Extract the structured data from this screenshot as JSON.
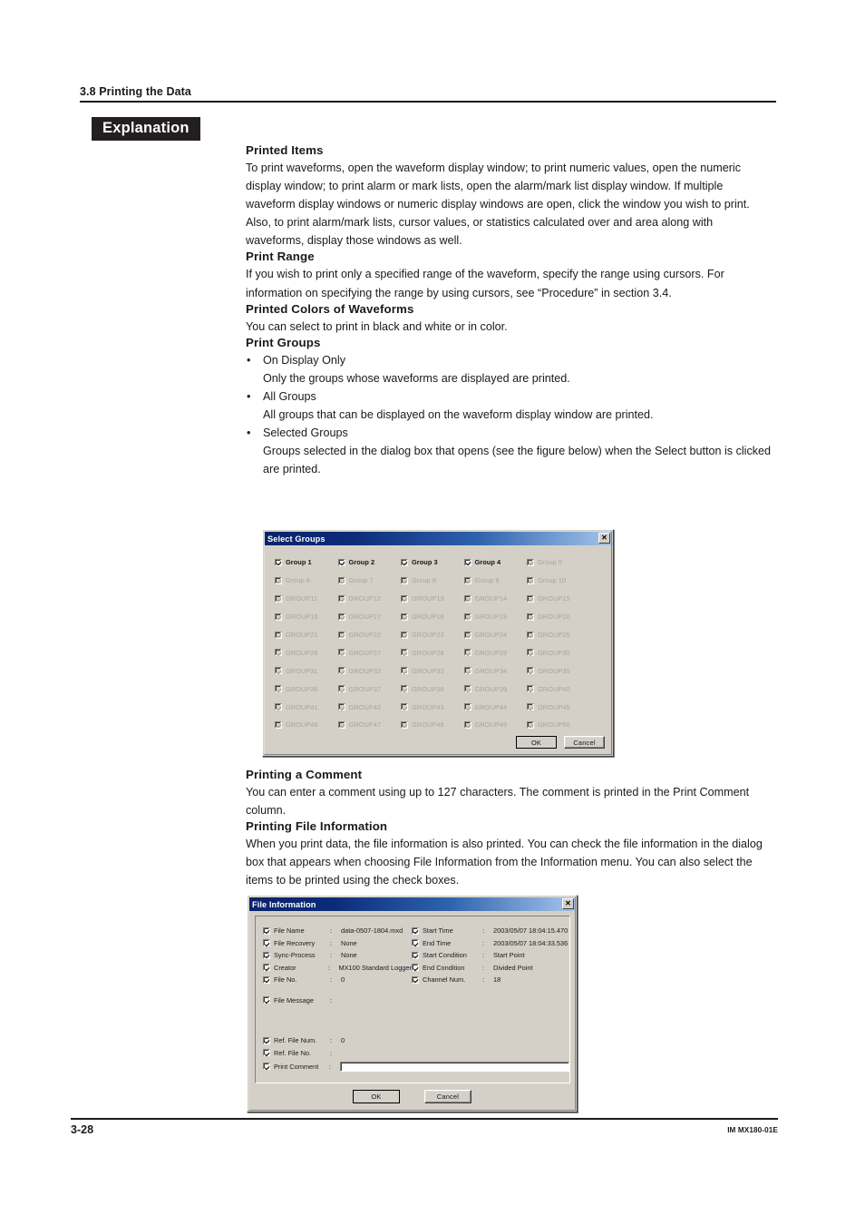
{
  "running_head": {
    "title": "3.8  Printing the Data"
  },
  "explanation_tag": {
    "label": "Explanation"
  },
  "sections": {
    "printed_items": {
      "heading": "Printed Items",
      "para1": "To print waveforms, open the waveform display window; to print numeric values, open the numeric display window; to print alarm or mark lists, open the alarm/mark list display window. If multiple waveform display windows or numeric display windows are open, click the window you wish to print.",
      "para2": "Also, to print alarm/mark lists, cursor values, or statistics calculated over and area along with waveforms, display those windows as well."
    },
    "print_range": {
      "heading": "Print Range",
      "para1": "If you wish to print only a specified range of the waveform, specify the range using cursors. For information on specifying the range by using cursors, see “Procedure” in section 3.4."
    },
    "printed_colors": {
      "heading": "Printed Colors of Waveforms",
      "para1": "You can select to print in black and white or in color."
    },
    "print_groups": {
      "heading": "Print Groups",
      "bullet_marker": "•",
      "items": [
        {
          "label": "On Display Only",
          "desc": "Only the groups whose waveforms are displayed are printed."
        },
        {
          "label": "All Groups",
          "desc": "All groups that can be displayed on the waveform display window are printed."
        },
        {
          "label": "Selected Groups",
          "desc": "Groups selected in the dialog box that opens (see the figure below) when the Select button is clicked are printed."
        }
      ]
    },
    "printing_comment": {
      "heading": "Printing a Comment",
      "para1": "You can enter a comment using up to 127 characters. The comment is printed in the Print Comment column."
    },
    "printing_file_info": {
      "heading": "Printing File Information",
      "para1": "When you print data, the file information is also printed. You can check the file information in the dialog box that appears when choosing File Information from the Information menu. You can also select the items to be printed using the check boxes."
    }
  },
  "select_groups_dialog": {
    "title": "Select Groups",
    "close_label": "✕",
    "groups": [
      {
        "label": "Group 1",
        "enabled": true
      },
      {
        "label": "Group 2",
        "enabled": true
      },
      {
        "label": "Group 3",
        "enabled": true
      },
      {
        "label": "Group 4",
        "enabled": true
      },
      {
        "label": "Group 5",
        "enabled": false
      },
      {
        "label": "Group 6",
        "enabled": false
      },
      {
        "label": "Group 7",
        "enabled": false
      },
      {
        "label": "Group 8",
        "enabled": false
      },
      {
        "label": "Group 9",
        "enabled": false
      },
      {
        "label": "Group 10",
        "enabled": false
      },
      {
        "label": "GROUP11",
        "enabled": false
      },
      {
        "label": "GROUP12",
        "enabled": false
      },
      {
        "label": "GROUP13",
        "enabled": false
      },
      {
        "label": "GROUP14",
        "enabled": false
      },
      {
        "label": "GROUP15",
        "enabled": false
      },
      {
        "label": "GROUP16",
        "enabled": false
      },
      {
        "label": "GROUP17",
        "enabled": false
      },
      {
        "label": "GROUP18",
        "enabled": false
      },
      {
        "label": "GROUP19",
        "enabled": false
      },
      {
        "label": "GROUP20",
        "enabled": false
      },
      {
        "label": "GROUP21",
        "enabled": false
      },
      {
        "label": "GROUP22",
        "enabled": false
      },
      {
        "label": "GROUP23",
        "enabled": false
      },
      {
        "label": "GROUP24",
        "enabled": false
      },
      {
        "label": "GROUP25",
        "enabled": false
      },
      {
        "label": "GROUP26",
        "enabled": false
      },
      {
        "label": "GROUP27",
        "enabled": false
      },
      {
        "label": "GROUP28",
        "enabled": false
      },
      {
        "label": "GROUP29",
        "enabled": false
      },
      {
        "label": "GROUP30",
        "enabled": false
      },
      {
        "label": "GROUP31",
        "enabled": false
      },
      {
        "label": "GROUP32",
        "enabled": false
      },
      {
        "label": "GROUP33",
        "enabled": false
      },
      {
        "label": "GROUP34",
        "enabled": false
      },
      {
        "label": "GROUP35",
        "enabled": false
      },
      {
        "label": "GROUP36",
        "enabled": false
      },
      {
        "label": "GROUP37",
        "enabled": false
      },
      {
        "label": "GROUP38",
        "enabled": false
      },
      {
        "label": "GROUP39",
        "enabled": false
      },
      {
        "label": "GROUP40",
        "enabled": false
      },
      {
        "label": "GROUP41",
        "enabled": false
      },
      {
        "label": "GROUP42",
        "enabled": false
      },
      {
        "label": "GROUP43",
        "enabled": false
      },
      {
        "label": "GROUP44",
        "enabled": false
      },
      {
        "label": "GROUP45",
        "enabled": false
      },
      {
        "label": "GROUP46",
        "enabled": false
      },
      {
        "label": "GROUP47",
        "enabled": false
      },
      {
        "label": "GROUP48",
        "enabled": false
      },
      {
        "label": "GROUP49",
        "enabled": false
      },
      {
        "label": "GROUP50",
        "enabled": false
      }
    ],
    "ok_label": "OK",
    "cancel_label": "Cancel"
  },
  "file_information_dialog": {
    "title": "File Information",
    "close_label": "✕",
    "colon": ":",
    "left_fields": [
      {
        "label": "File Name",
        "value": "data-0507-1804.mxd"
      },
      {
        "label": "File Recovery",
        "value": "None"
      },
      {
        "label": "Sync-Process",
        "value": "None"
      },
      {
        "label": "Creator",
        "value": "MX100 Standard Logger"
      },
      {
        "label": "File No.",
        "value": "0"
      }
    ],
    "right_fields": [
      {
        "label": "Start Time",
        "value": "2003/05/07 18:04:15.470"
      },
      {
        "label": "End Time",
        "value": "2003/05/07 18:04:33.536"
      },
      {
        "label": "Start Condition",
        "value": "Start Point"
      },
      {
        "label": "End Condition",
        "value": "Divided Point"
      },
      {
        "label": "Channel Num.",
        "value": "18"
      }
    ],
    "message_field": {
      "label": "File Message",
      "value": ""
    },
    "ref_fields": [
      {
        "label": "Ref. File Num.",
        "value": "0"
      },
      {
        "label": "Ref. File No.",
        "value": ""
      }
    ],
    "comment_field": {
      "label": "Print Comment",
      "value": "",
      "placeholder": ""
    },
    "ok_label": "OK",
    "cancel_label": "Cancel"
  },
  "footer": {
    "page_number": "3-28",
    "manual_code": "IM MX180-01E"
  }
}
